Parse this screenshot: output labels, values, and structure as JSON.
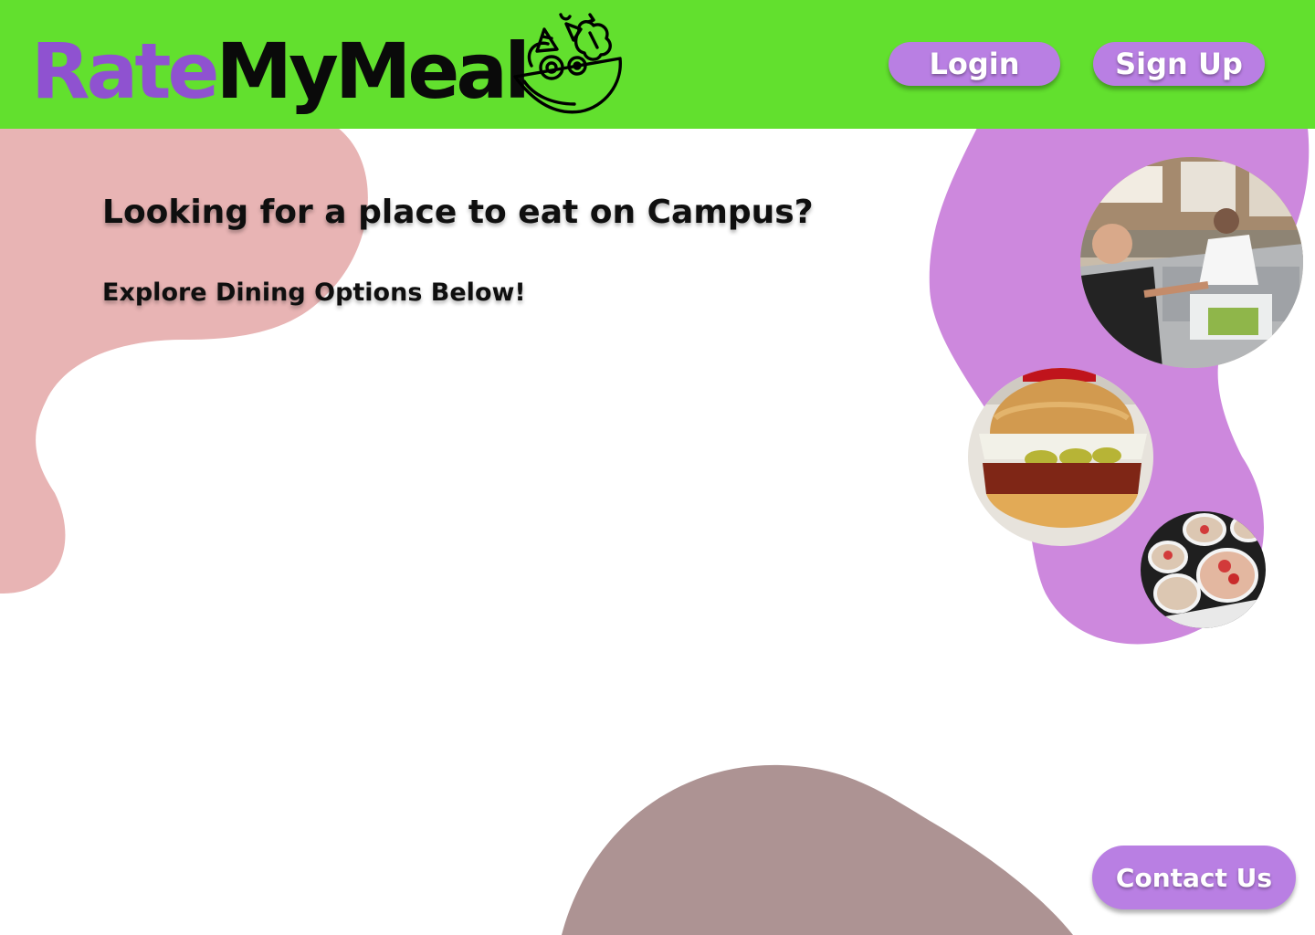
{
  "header": {
    "logo": {
      "part1": "Rate",
      "part2": "MyMeal",
      "icon": "salad-bowl-icon"
    },
    "login_label": "Login",
    "signup_label": "Sign Up"
  },
  "main": {
    "heading": "Looking for a place to eat on Campus?",
    "subheading": "Explore Dining Options Below!",
    "photos": [
      {
        "name": "dining-hall-photo"
      },
      {
        "name": "burger-photo"
      },
      {
        "name": "dessert-plates-photo"
      }
    ]
  },
  "footer": {
    "contact_label": "Contact Us"
  },
  "colors": {
    "header_green": "#62e02e",
    "brand_purple": "#8f52d0",
    "button_purple": "#b97fe3",
    "blob_pink": "#e8b4b4",
    "blob_lilac": "#cd88dd",
    "blob_mauve": "#ad9393"
  }
}
